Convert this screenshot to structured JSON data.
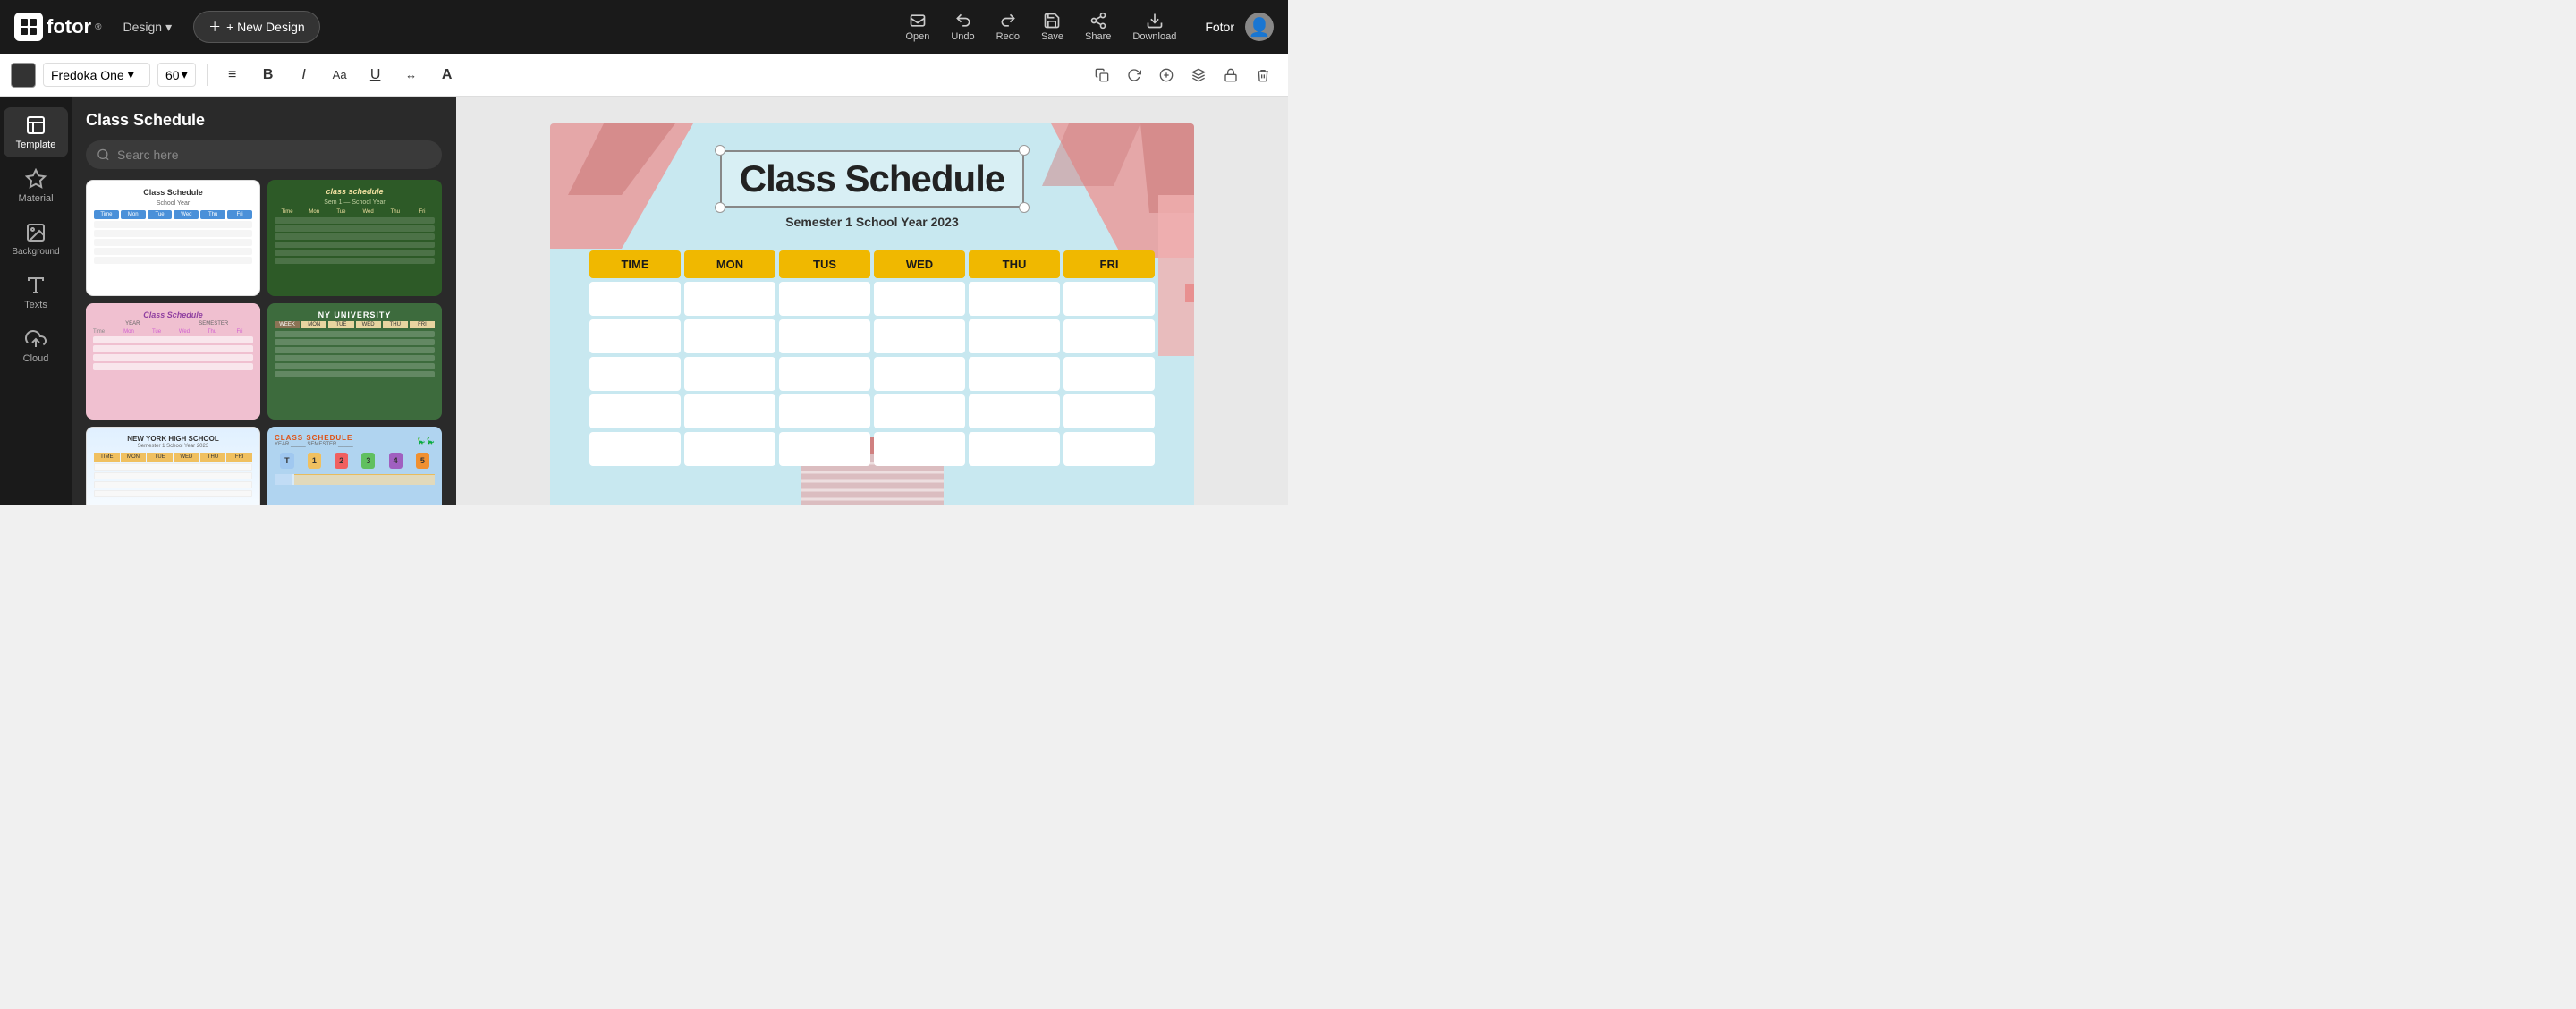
{
  "topnav": {
    "logo_text": "fotor",
    "design_label": "Design",
    "new_design_label": "+ New Design",
    "tools": [
      {
        "id": "open",
        "label": "Open",
        "icon": "open"
      },
      {
        "id": "undo",
        "label": "Undo",
        "icon": "undo"
      },
      {
        "id": "redo",
        "label": "Redo",
        "icon": "redo"
      },
      {
        "id": "save",
        "label": "Save",
        "icon": "save"
      },
      {
        "id": "share",
        "label": "Share",
        "icon": "share"
      },
      {
        "id": "download",
        "label": "Download",
        "icon": "download"
      }
    ],
    "username": "Fotor",
    "avatar_icon": "👤"
  },
  "toolbar": {
    "font_name": "Fredoka One",
    "font_size": "60",
    "align_icon": "≡",
    "bold_icon": "B",
    "italic_icon": "I",
    "aa_icon": "Aa",
    "underline_icon": "U",
    "spacing_icon": "↔",
    "case_icon": "A"
  },
  "sidebar": {
    "items": [
      {
        "id": "template",
        "label": "Template",
        "active": true
      },
      {
        "id": "material",
        "label": "Material",
        "active": false
      },
      {
        "id": "background",
        "label": "Background",
        "active": false
      },
      {
        "id": "texts",
        "label": "Texts",
        "active": false
      },
      {
        "id": "cloud",
        "label": "Cloud",
        "active": false
      }
    ]
  },
  "template_panel": {
    "title": "Class Schedule",
    "search_placeholder": "Searc here"
  },
  "canvas": {
    "title": "Class Schedule",
    "subtitle": "Semester 1 School Year 2023",
    "table_headers": [
      "TIME",
      "MON",
      "TUS",
      "WED",
      "THU",
      "FRI"
    ],
    "table_rows": 5
  }
}
